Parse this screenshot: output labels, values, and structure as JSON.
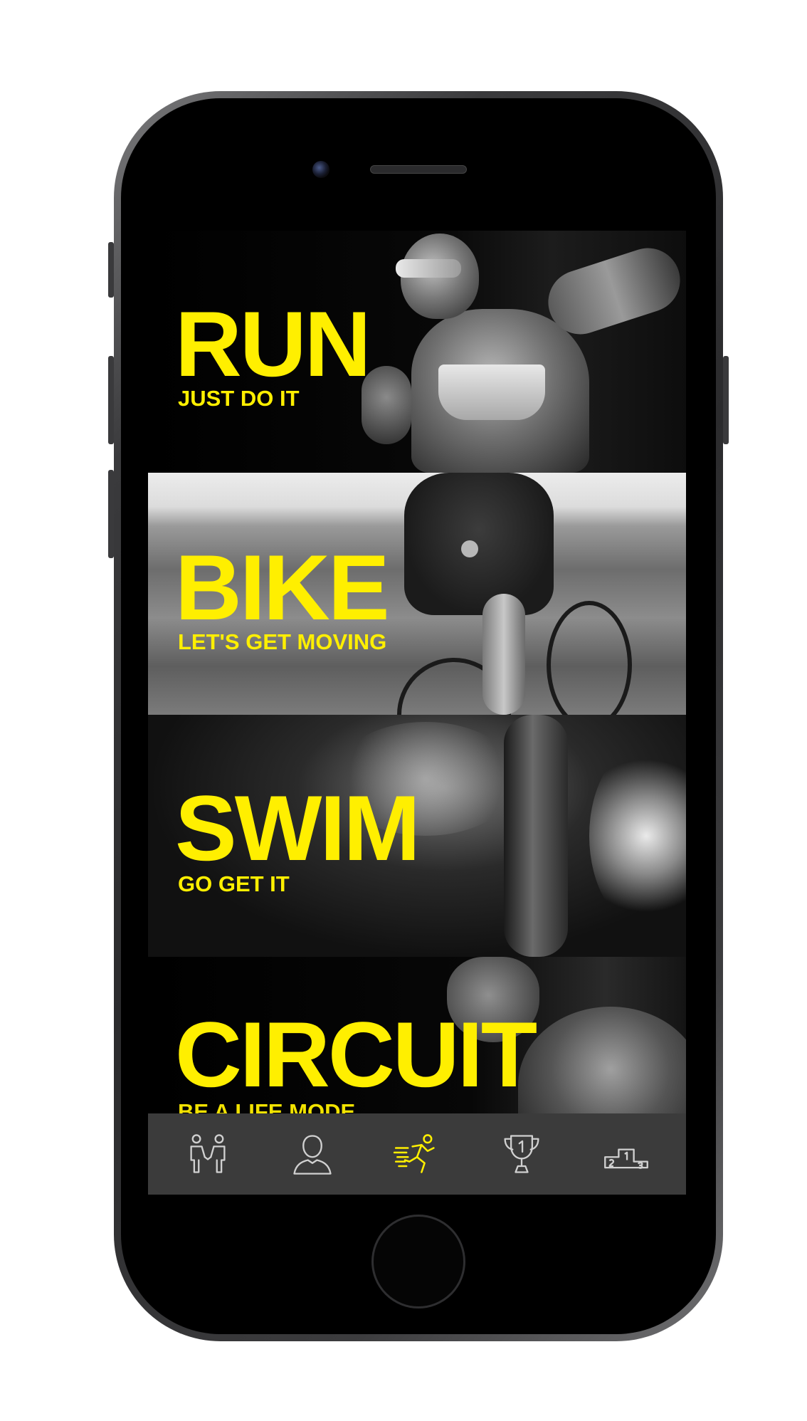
{
  "colors": {
    "accent": "#ffef00",
    "tab_bar": "#3b3b3b",
    "icon_inactive": "#d0d0d0",
    "icon_active": "#ffef00"
  },
  "panels": [
    {
      "title": "RUN",
      "subtitle": "JUST DO IT"
    },
    {
      "title": "BIKE",
      "subtitle": "LET'S GET MOVING"
    },
    {
      "title": "SWIM",
      "subtitle": "GO GET IT"
    },
    {
      "title": "CIRCUIT",
      "subtitle": "BE A LIFE MODE"
    }
  ],
  "tab_bar": {
    "tabs": [
      {
        "icon": "handshake-icon",
        "active": false
      },
      {
        "icon": "profile-icon",
        "active": false
      },
      {
        "icon": "runner-icon",
        "active": true
      },
      {
        "icon": "trophy-icon",
        "active": false
      },
      {
        "icon": "podium-icon",
        "active": false
      }
    ]
  }
}
